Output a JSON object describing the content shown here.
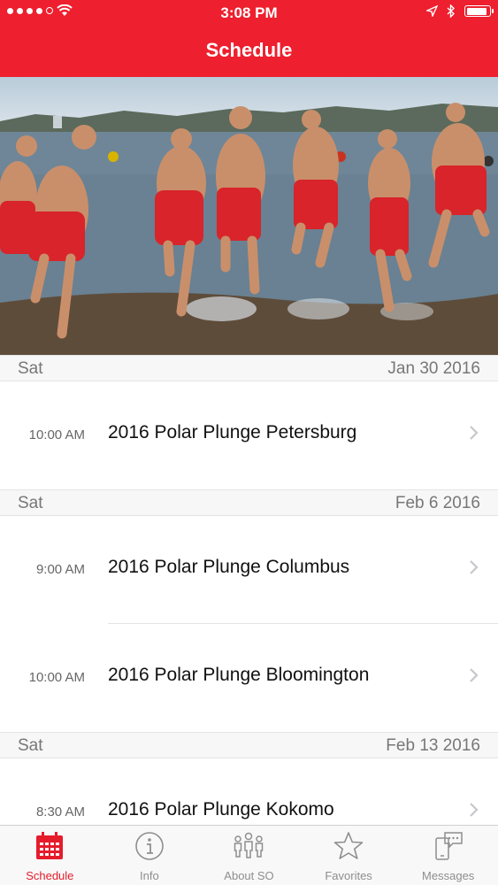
{
  "status_bar": {
    "time": "3:08 PM"
  },
  "header": {
    "title": "Schedule"
  },
  "hero": {
    "description_icon": "photo"
  },
  "sections": [
    {
      "day": "Sat",
      "date": "Jan 30 2016",
      "events": [
        {
          "time": "10:00 AM",
          "title": "2016 Polar Plunge Petersburg"
        }
      ]
    },
    {
      "day": "Sat",
      "date": "Feb 6 2016",
      "events": [
        {
          "time": "9:00 AM",
          "title": "2016 Polar Plunge Columbus"
        },
        {
          "time": "10:00 AM",
          "title": "2016 Polar Plunge Bloomington"
        }
      ]
    },
    {
      "day": "Sat",
      "date": "Feb 13 2016",
      "events": [
        {
          "time": "8:30 AM",
          "title": "2016 Polar Plunge Kokomo"
        }
      ]
    }
  ],
  "tabs": [
    {
      "label": "Schedule",
      "icon": "calendar-icon",
      "active": true
    },
    {
      "label": "Info",
      "icon": "info-icon",
      "active": false
    },
    {
      "label": "About SO",
      "icon": "people-icon",
      "active": false
    },
    {
      "label": "Favorites",
      "icon": "star-icon",
      "active": false
    },
    {
      "label": "Messages",
      "icon": "messages-icon",
      "active": false
    }
  ],
  "colors": {
    "accent": "#ee1f2e",
    "tab_active": "#e51c2b",
    "tab_inactive": "#8e8e8e"
  }
}
